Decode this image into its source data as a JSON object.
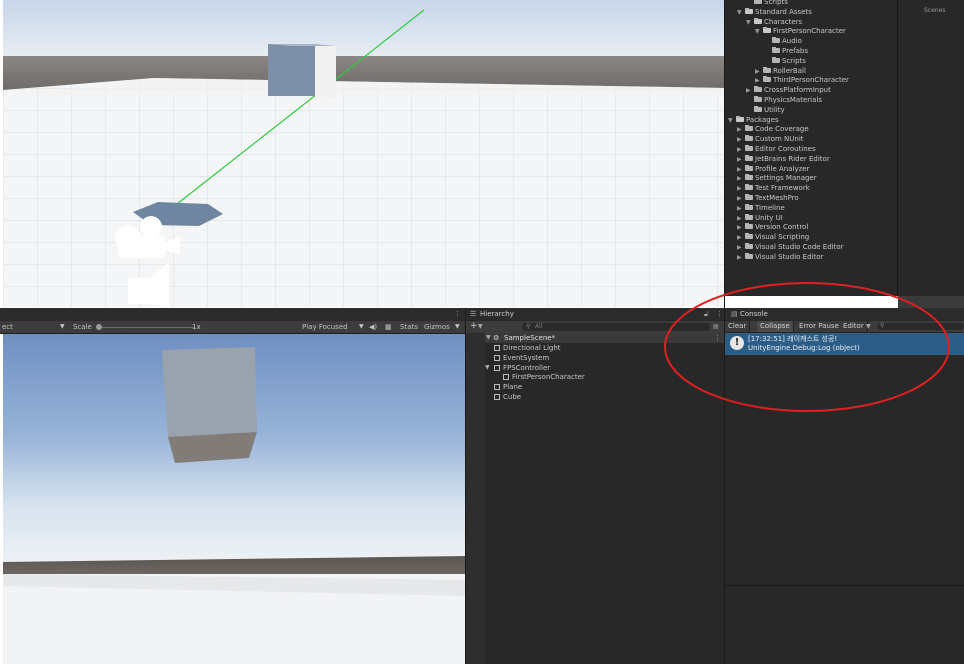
{
  "project": {
    "side_label": "Scenes",
    "items": [
      {
        "label": "Scripts",
        "depth": 2,
        "expanded": null
      },
      {
        "label": "Standard Assets",
        "depth": 1,
        "expanded": true
      },
      {
        "label": "Characters",
        "depth": 2,
        "expanded": true
      },
      {
        "label": "FirstPersonCharacter",
        "depth": 3,
        "expanded": true
      },
      {
        "label": "Audio",
        "depth": 4,
        "expanded": null
      },
      {
        "label": "Prefabs",
        "depth": 4,
        "expanded": null
      },
      {
        "label": "Scripts",
        "depth": 4,
        "expanded": null
      },
      {
        "label": "RollerBall",
        "depth": 3,
        "expanded": false
      },
      {
        "label": "ThirdPersonCharacter",
        "depth": 3,
        "expanded": false
      },
      {
        "label": "CrossPlatformInput",
        "depth": 2,
        "expanded": false
      },
      {
        "label": "PhysicsMaterials",
        "depth": 2,
        "expanded": null
      },
      {
        "label": "Utility",
        "depth": 2,
        "expanded": null
      },
      {
        "label": "Packages",
        "depth": 0,
        "expanded": true
      },
      {
        "label": "Code Coverage",
        "depth": 1,
        "expanded": false
      },
      {
        "label": "Custom NUnit",
        "depth": 1,
        "expanded": false
      },
      {
        "label": "Editor Coroutines",
        "depth": 1,
        "expanded": false
      },
      {
        "label": "JetBrains Rider Editor",
        "depth": 1,
        "expanded": false
      },
      {
        "label": "Profile Analyzer",
        "depth": 1,
        "expanded": false
      },
      {
        "label": "Settings Manager",
        "depth": 1,
        "expanded": false
      },
      {
        "label": "Test Framework",
        "depth": 1,
        "expanded": false
      },
      {
        "label": "TextMeshPro",
        "depth": 1,
        "expanded": false
      },
      {
        "label": "Timeline",
        "depth": 1,
        "expanded": false
      },
      {
        "label": "Unity UI",
        "depth": 1,
        "expanded": false
      },
      {
        "label": "Version Control",
        "depth": 1,
        "expanded": false
      },
      {
        "label": "Visual Scripting",
        "depth": 1,
        "expanded": false
      },
      {
        "label": "Visual Studio Code Editor",
        "depth": 1,
        "expanded": false
      },
      {
        "label": "Visual Studio Editor",
        "depth": 1,
        "expanded": false
      }
    ]
  },
  "game": {
    "display_label": "ect",
    "scale_label": "Scale",
    "scale_value": "1x",
    "play_mode": "Play Focused",
    "stats_label": "Stats",
    "gizmos_label": "Gizmos"
  },
  "hierarchy": {
    "tab_label": "Hierarchy",
    "add_label": "+",
    "search_placeholder": "All",
    "scene_name": "SampleScene*",
    "objects": [
      {
        "label": "Directional Light",
        "depth": 1,
        "expanded": null
      },
      {
        "label": "EventSystem",
        "depth": 1,
        "expanded": null
      },
      {
        "label": "FPSController",
        "depth": 1,
        "expanded": true
      },
      {
        "label": "FirstPersonCharacter",
        "depth": 2,
        "expanded": null
      },
      {
        "label": "Plane",
        "depth": 1,
        "expanded": null
      },
      {
        "label": "Cube",
        "depth": 1,
        "expanded": null
      }
    ]
  },
  "console": {
    "tab_label": "Console",
    "buttons": {
      "clear": "Clear",
      "collapse": "Collapse",
      "error_pause": "Error Pause",
      "editor": "Editor"
    },
    "entries": [
      {
        "line1": "[17:32:51] 레이캐스트 성공!",
        "line2": "UnityEngine.Debug:Log (object)"
      }
    ]
  },
  "colors": {
    "selection": "#2c5d87",
    "annotation": "#e02020",
    "ray": "#2ecc40"
  }
}
